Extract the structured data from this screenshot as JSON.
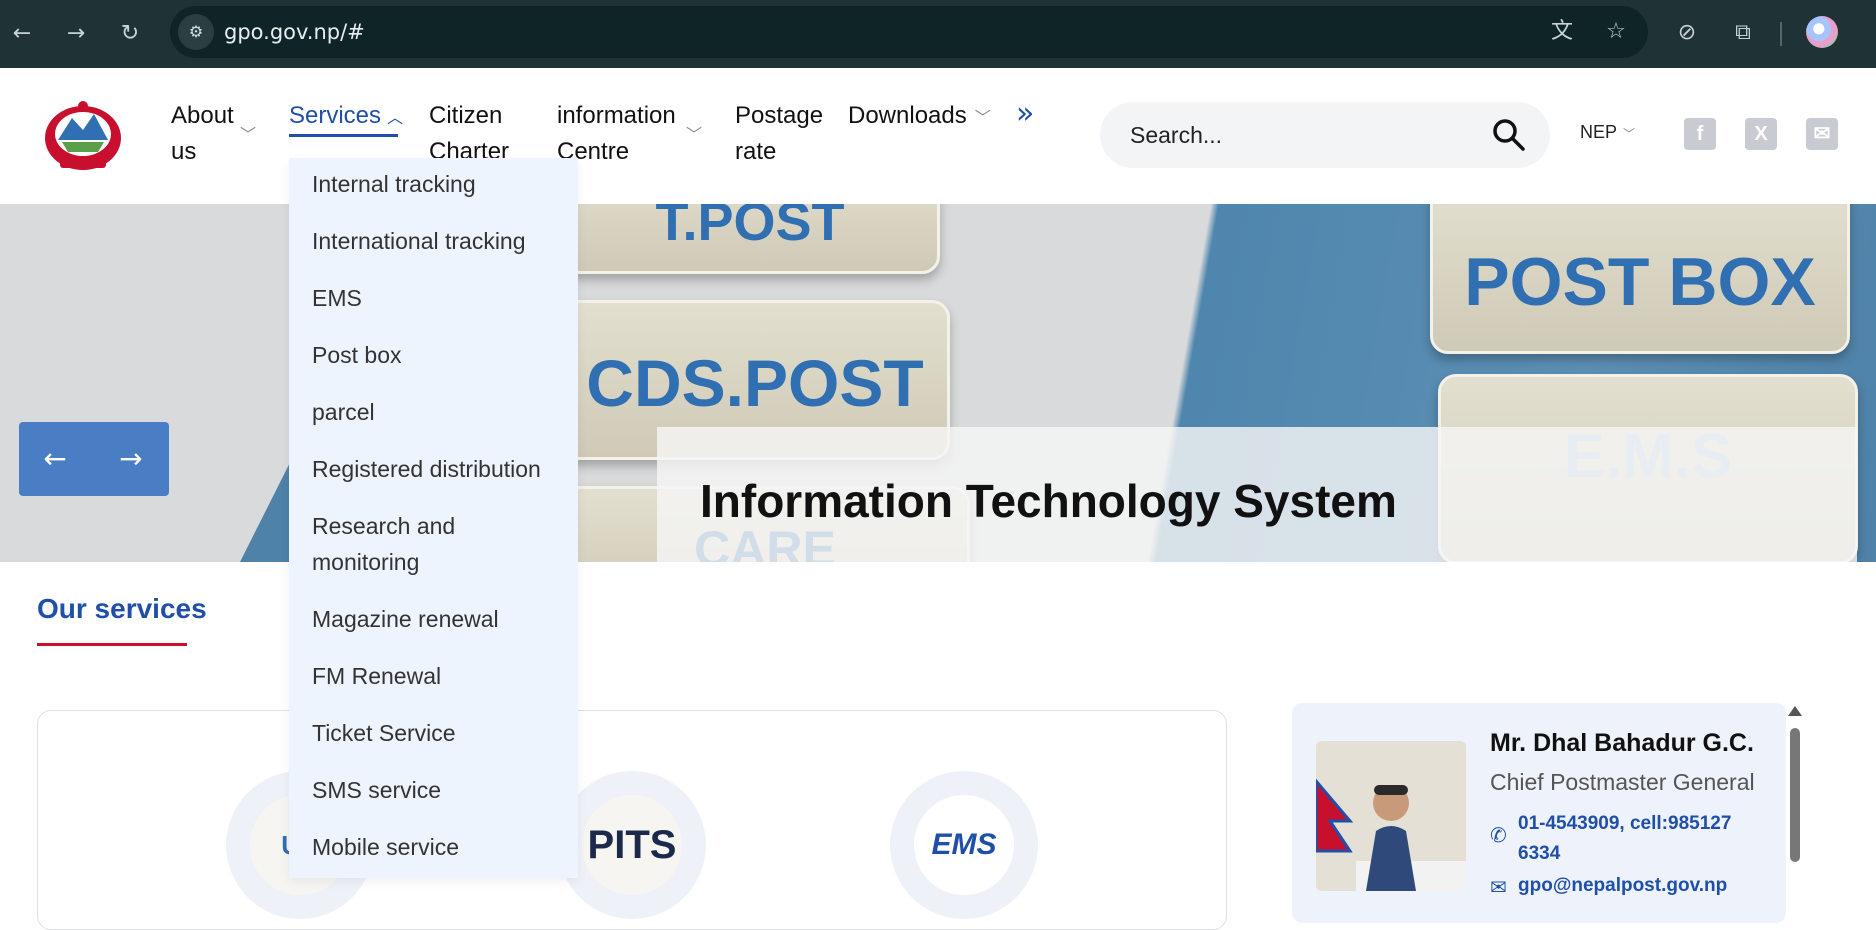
{
  "browser": {
    "url": "gpo.gov.np/#",
    "back_icon": "←",
    "forward_icon": "→",
    "reload_icon": "↻"
  },
  "nav": {
    "about": "About\nus",
    "services": "Services",
    "citizen": "Citizen\nCharter",
    "information": "information\nCentre",
    "postage": "Postage\nrate",
    "downloads": "Downloads",
    "more": "»"
  },
  "search": {
    "placeholder": "Search..."
  },
  "lang": "NEP",
  "social": {
    "facebook": "f",
    "x": "X",
    "mail": "✉"
  },
  "hero": {
    "caption": "Information Technology System",
    "keys": [
      "POST BOX",
      "CDS.POST",
      "E.M.S",
      "T.POST",
      "CARE"
    ],
    "prev": "←",
    "next": "→"
  },
  "services_menu": [
    "Internal tracking",
    "International tracking",
    "EMS",
    "Post box",
    "parcel",
    "Registered distribution",
    "Research and monitoring",
    "Magazine renewal",
    "FM Renewal",
    "Ticket Service",
    "SMS service",
    "Mobile service"
  ],
  "our_services": {
    "title": "Our services",
    "logos": [
      "UN",
      "PITS",
      "EMS"
    ]
  },
  "profile": {
    "name": "Mr. Dhal Bahadur G.C.",
    "role": "Chief Postmaster General",
    "phone": "01-4543909, cell:9851276334",
    "email": "gpo@nepalpost.gov.np"
  },
  "colors": {
    "brand_blue": "#1f4fa8",
    "accent_red": "#c8102e"
  }
}
